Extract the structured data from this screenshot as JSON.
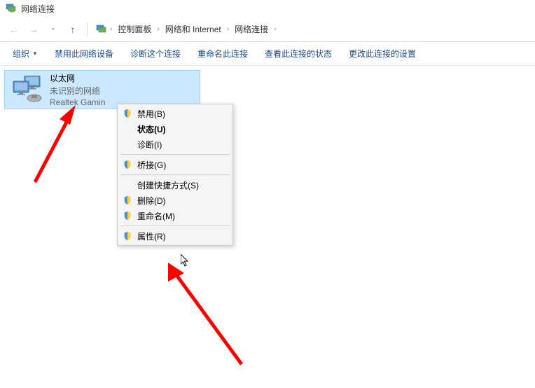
{
  "title": "网络连接",
  "breadcrumb": {
    "item1": "控制面板",
    "item2": "网络和 Internet",
    "item3": "网络连接"
  },
  "commands": {
    "organize": "组织",
    "disable": "禁用此网络设备",
    "diagnose": "诊断这个连接",
    "rename": "重命名此连接",
    "status": "查看此连接的状态",
    "change": "更改此连接的设置"
  },
  "adapter": {
    "name": "以太网",
    "status": "未识别的网络",
    "driver": "Realtek Gamin"
  },
  "context_menu": {
    "disable": "禁用(B)",
    "status": "状态(U)",
    "diagnose": "诊断(I)",
    "bridge": "桥接(G)",
    "shortcut": "创建快捷方式(S)",
    "delete": "删除(D)",
    "rename": "重命名(M)",
    "properties": "属性(R)"
  }
}
